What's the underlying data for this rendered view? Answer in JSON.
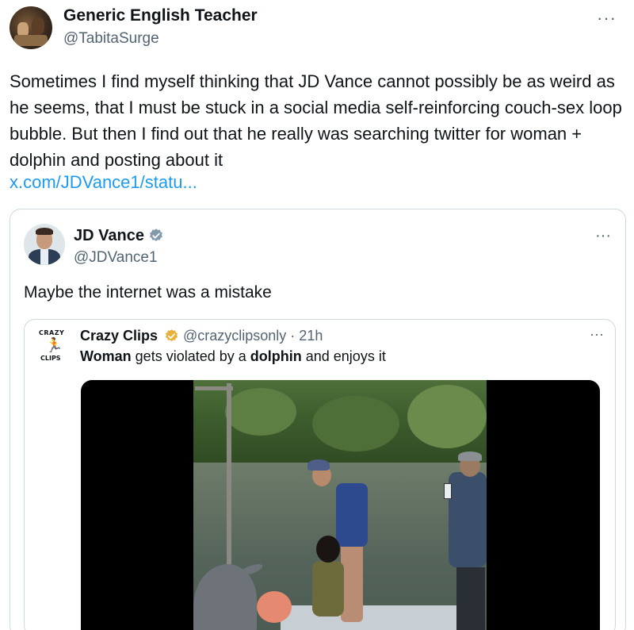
{
  "tweet": {
    "author_name": "Generic English Teacher",
    "author_handle": "@TabitaSurge",
    "more": "···",
    "text": "Sometimes I find myself thinking that JD Vance cannot possibly be as weird as he seems, that I must be stuck in a social media self-reinforcing couch-sex loop bubble. But then I find out that he really was searching twitter for woman + dolphin and posting about it",
    "link": "x.com/JDVance1/statu..."
  },
  "quote": {
    "author_name": "JD Vance",
    "author_handle": "@JDVance1",
    "more": "···",
    "text": "Maybe the internet was a mistake",
    "verified_color": "#829aab"
  },
  "inner_quote": {
    "author_name": "Crazy Clips",
    "author_handle": "@crazyclipsonly · 21h",
    "more": "···",
    "logo_top": "CRAZY",
    "logo_bottom": "CLIPS",
    "text_bold_1": "Woman",
    "text_plain_1": " gets violated by a ",
    "text_bold_2": "dolphin",
    "text_plain_2": " and enjoys it",
    "verified_color": "#e8b23a"
  },
  "icons": {
    "verified": "verified-badge-icon",
    "more": "more-options-icon"
  }
}
